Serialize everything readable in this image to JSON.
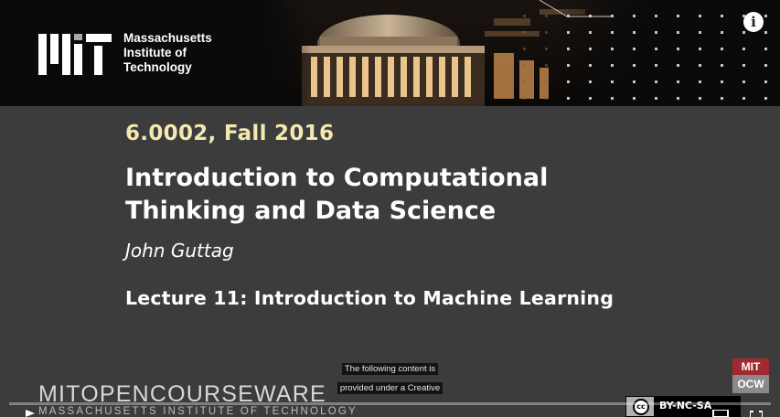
{
  "institution": {
    "name_lines": [
      "Massachusetts",
      "Institute of",
      "Technology"
    ],
    "logo": "mit-logo"
  },
  "slide": {
    "course": "6.0002, Fall 2016",
    "title_lines": [
      "Introduction to Computational",
      "Thinking and Data Science"
    ],
    "author": "John Guttag",
    "lecture": "Lecture 11: Introduction to Machine Learning"
  },
  "captions": {
    "lines": [
      "The following content is",
      "provided under a Creative"
    ]
  },
  "ocw": {
    "wordmark": "MITOPENCOURSEWARE",
    "subtitle": "MASSACHUSETTS INSTITUTE OF TECHNOLOGY",
    "badge_top": "MIT",
    "badge_bottom": "OCW"
  },
  "license": {
    "cc_symbol": "cc",
    "label": "BY-NC-SA"
  },
  "player": {
    "info_label": "i",
    "progress_fraction": 0.0,
    "icons": [
      "info-icon",
      "play-icon",
      "settings-icon",
      "fullscreen-icon"
    ]
  },
  "colors": {
    "slide_bg": "#3c3c3c",
    "course_text": "#f3e8b0",
    "badge_red": "#a32931",
    "badge_gray": "#8a8a8a",
    "progress_red": "#ff0000"
  }
}
